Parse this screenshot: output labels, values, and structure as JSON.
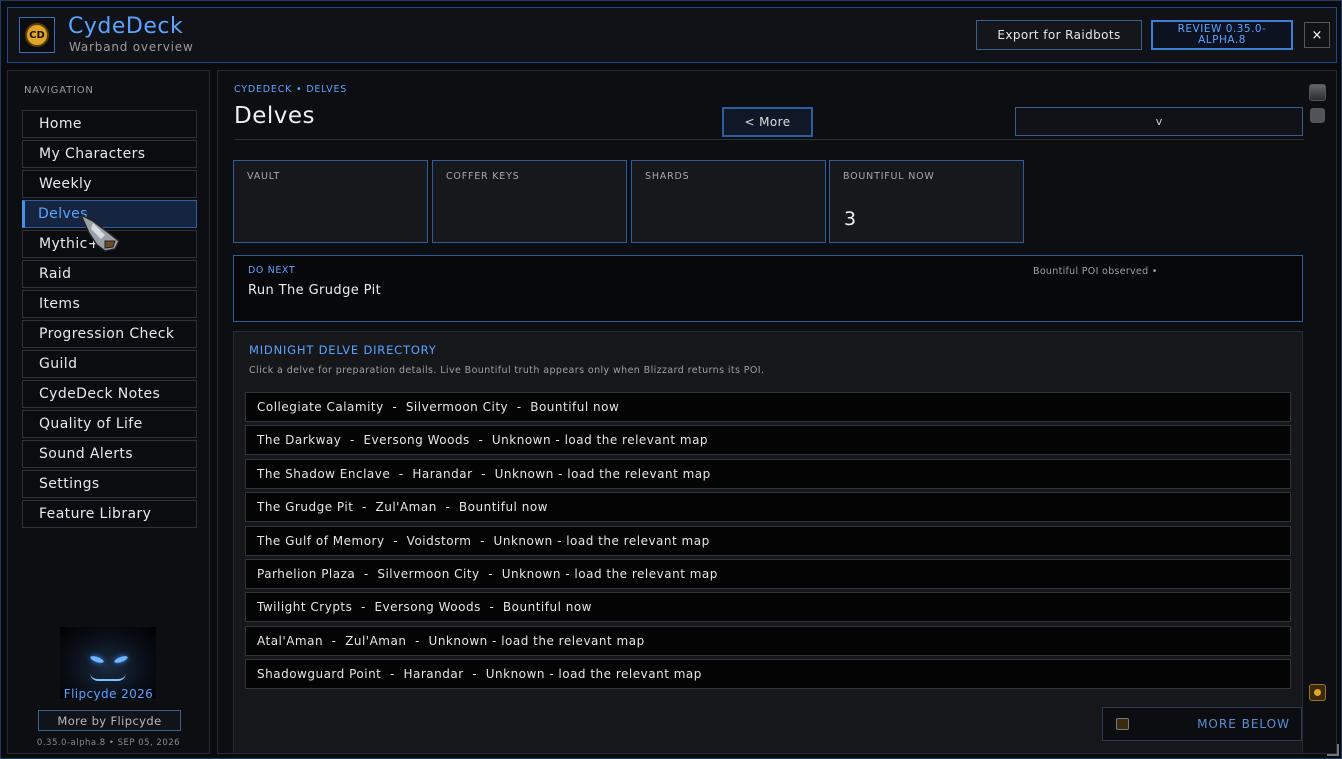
{
  "header": {
    "logo_text": "CD",
    "title": "CydeDeck",
    "subtitle": "Warband overview",
    "export_label": "Export for Raidbots",
    "review_label": "REVIEW 0.35.0-ALPHA.8",
    "close_label": "×"
  },
  "sidebar": {
    "heading": "NAVIGATION",
    "items": [
      {
        "label": "Home"
      },
      {
        "label": "My Characters"
      },
      {
        "label": "Weekly"
      },
      {
        "label": "Delves"
      },
      {
        "label": "Mythic+"
      },
      {
        "label": "Raid"
      },
      {
        "label": "Items"
      },
      {
        "label": "Progression Check"
      },
      {
        "label": "Guild"
      },
      {
        "label": "CydeDeck Notes"
      },
      {
        "label": "Quality of Life"
      },
      {
        "label": "Sound Alerts"
      },
      {
        "label": "Settings"
      },
      {
        "label": "Feature Library"
      }
    ],
    "active_index": 3,
    "creator": "Flipcyde 2026",
    "more_by_label": "More by Flipcyde",
    "version": "0.35.0-alpha.8  •  SEP 05, 2026"
  },
  "main": {
    "breadcrumb": "CYDEDECK  •  DELVES",
    "title": "Delves",
    "more_label": "< More",
    "select_value": "v",
    "stats": [
      {
        "label": "VAULT",
        "value": ""
      },
      {
        "label": "COFFER KEYS",
        "value": ""
      },
      {
        "label": "SHARDS",
        "value": ""
      },
      {
        "label": "BOUNTIFUL NOW",
        "value": "3"
      }
    ],
    "do_next": {
      "label": "DO NEXT",
      "text": "Run The Grudge Pit",
      "status": "Bountiful POI observed •"
    },
    "directory": {
      "title": "MIDNIGHT DELVE DIRECTORY",
      "description": "Click a delve for preparation details. Live Bountiful truth appears only when Blizzard returns its POI.",
      "rows": [
        "Collegiate Calamity  -  Silvermoon City  -  Bountiful now",
        "The Darkway  -  Eversong Woods  -  Unknown - load the relevant map",
        "The Shadow Enclave  -  Harandar  -  Unknown - load the relevant map",
        "The Grudge Pit  -  Zul'Aman  -  Bountiful now",
        "The Gulf of Memory  -  Voidstorm  -  Unknown - load the relevant map",
        "Parhelion Plaza  -  Silvermoon City  -  Unknown - load the relevant map",
        "Twilight Crypts  -  Eversong Woods  -  Bountiful now",
        "Atal'Aman  -  Zul'Aman  -  Unknown - load the relevant map",
        "Shadowguard Point  -  Harandar  -  Unknown - load the relevant map"
      ]
    },
    "more_below_label": "MORE BELOW"
  },
  "icons": {
    "logo": "cydedeck-coin-icon",
    "cursor": "gauntlet-cursor-icon",
    "scroll_up": "scroll-up-icon",
    "scroll_down": "scroll-down-icon",
    "more_below": "more-below-icon"
  },
  "colors": {
    "accent": "#5aa3ff",
    "border_accent": "#2f5c9e",
    "background": "#0b0b0d",
    "gold": "#e0a526"
  }
}
